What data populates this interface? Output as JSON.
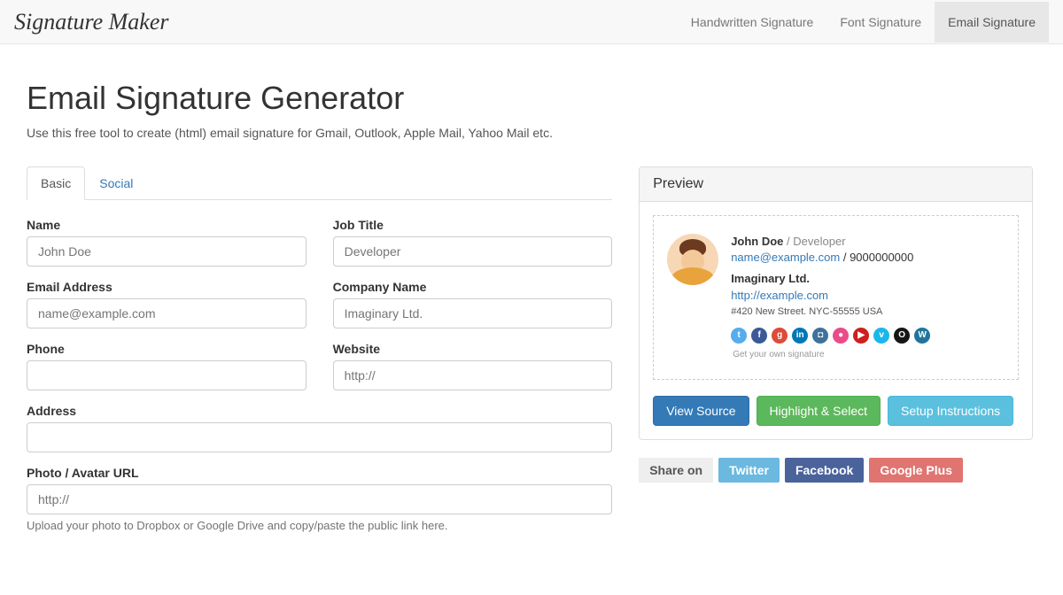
{
  "brand": "Signature Maker",
  "nav": {
    "handwritten": "Handwritten Signature",
    "font": "Font Signature",
    "email": "Email Signature"
  },
  "page": {
    "title": "Email Signature Generator",
    "subtitle": "Use this free tool to create (html) email signature for Gmail, Outlook, Apple Mail, Yahoo Mail etc."
  },
  "tabs": {
    "basic": "Basic",
    "social": "Social"
  },
  "form": {
    "name_label": "Name",
    "name_placeholder": "John Doe",
    "job_label": "Job Title",
    "job_placeholder": "Developer",
    "email_label": "Email Address",
    "email_placeholder": "name@example.com",
    "company_label": "Company Name",
    "company_placeholder": "Imaginary Ltd.",
    "phone_label": "Phone",
    "phone_placeholder": "",
    "website_label": "Website",
    "website_placeholder": "http://",
    "address_label": "Address",
    "address_placeholder": "",
    "photo_label": "Photo / Avatar URL",
    "photo_placeholder": "http://",
    "photo_help": "Upload your photo to Dropbox or Google Drive and copy/paste the public link here."
  },
  "preview": {
    "heading": "Preview",
    "name": "John Doe",
    "sep": " / ",
    "role": "Developer",
    "email": "name@example.com",
    "sep2": " / ",
    "phone": "9000000000",
    "company": "Imaginary Ltd.",
    "website": "http://example.com",
    "address": "#420 New Street. NYC-55555 USA",
    "own": "Get your own signature"
  },
  "buttons": {
    "view_source": "View Source",
    "highlight": "Highlight & Select",
    "setup": "Setup Instructions"
  },
  "share": {
    "label": "Share on",
    "twitter": "Twitter",
    "facebook": "Facebook",
    "google": "Google Plus"
  },
  "social_icons": [
    {
      "name": "twitter-icon",
      "bg": "#55acee",
      "txt": "t"
    },
    {
      "name": "facebook-icon",
      "bg": "#3b5998",
      "txt": "f"
    },
    {
      "name": "googleplus-icon",
      "bg": "#dd4b39",
      "txt": "g"
    },
    {
      "name": "linkedin-icon",
      "bg": "#0077b5",
      "txt": "in"
    },
    {
      "name": "instagram-icon",
      "bg": "#3f729b",
      "txt": "◘"
    },
    {
      "name": "dribbble-icon",
      "bg": "#ea4c89",
      "txt": "●"
    },
    {
      "name": "youtube-icon",
      "bg": "#cd201f",
      "txt": "▶"
    },
    {
      "name": "vimeo-icon",
      "bg": "#1ab7ea",
      "txt": "v"
    },
    {
      "name": "github-icon",
      "bg": "#171515",
      "txt": "O"
    },
    {
      "name": "wordpress-icon",
      "bg": "#21759b",
      "txt": "W"
    }
  ]
}
